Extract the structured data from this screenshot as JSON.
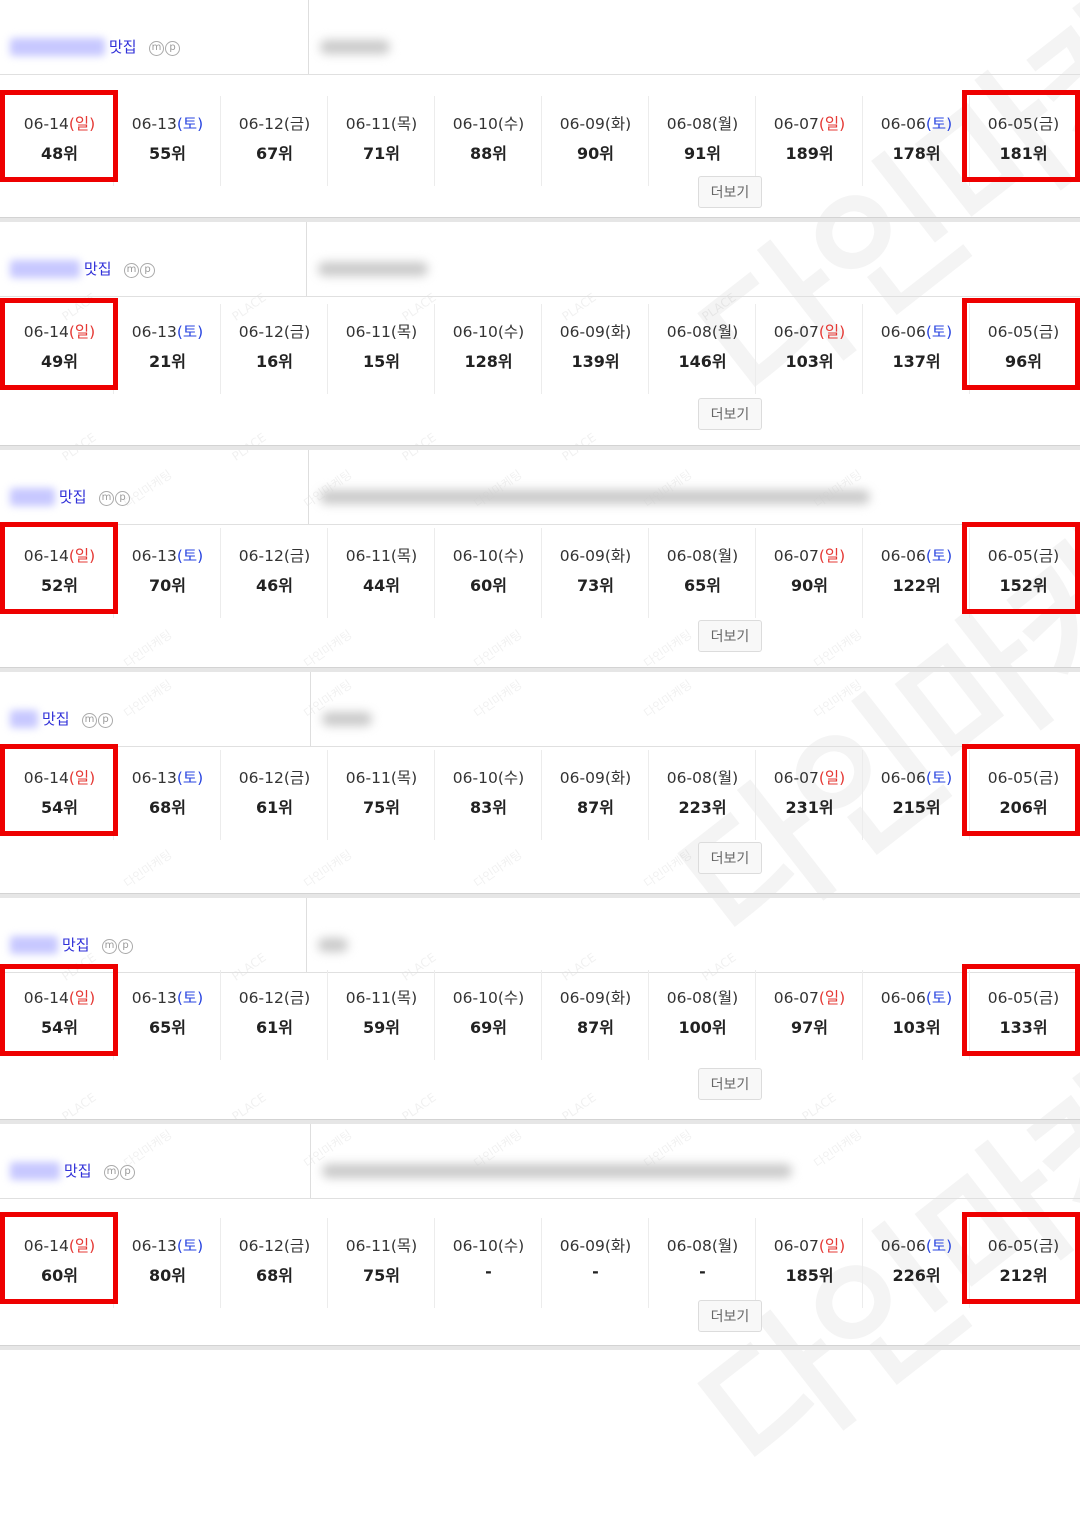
{
  "watermark_small": "다인마케팅",
  "watermark_place": "PLACE",
  "watermark_big": "다인마케",
  "blocks": [
    {
      "keyword_suffix": "맛집",
      "icons": [
        "m",
        "p"
      ],
      "more_label": "더보기",
      "days": [
        {
          "date": "06-14",
          "day": "(일)",
          "rank": "48위"
        },
        {
          "date": "06-13",
          "day": "(토)",
          "rank": "55위"
        },
        {
          "date": "06-12",
          "day": "(금)",
          "rank": "67위"
        },
        {
          "date": "06-11",
          "day": "(목)",
          "rank": "71위"
        },
        {
          "date": "06-10",
          "day": "(수)",
          "rank": "88위"
        },
        {
          "date": "06-09",
          "day": "(화)",
          "rank": "90위"
        },
        {
          "date": "06-08",
          "day": "(월)",
          "rank": "91위"
        },
        {
          "date": "06-07",
          "day": "(일)",
          "rank": "189위"
        },
        {
          "date": "06-06",
          "day": "(토)",
          "rank": "178위"
        },
        {
          "date": "06-05",
          "day": "(금)",
          "rank": "181위"
        }
      ]
    },
    {
      "keyword_suffix": "맛집",
      "icons": [
        "m",
        "p"
      ],
      "more_label": "더보기",
      "days": [
        {
          "date": "06-14",
          "day": "(일)",
          "rank": "49위"
        },
        {
          "date": "06-13",
          "day": "(토)",
          "rank": "21위"
        },
        {
          "date": "06-12",
          "day": "(금)",
          "rank": "16위"
        },
        {
          "date": "06-11",
          "day": "(목)",
          "rank": "15위"
        },
        {
          "date": "06-10",
          "day": "(수)",
          "rank": "128위"
        },
        {
          "date": "06-09",
          "day": "(화)",
          "rank": "139위"
        },
        {
          "date": "06-08",
          "day": "(월)",
          "rank": "146위"
        },
        {
          "date": "06-07",
          "day": "(일)",
          "rank": "103위"
        },
        {
          "date": "06-06",
          "day": "(토)",
          "rank": "137위"
        },
        {
          "date": "06-05",
          "day": "(금)",
          "rank": "96위"
        }
      ]
    },
    {
      "keyword_suffix": "맛집",
      "icons": [
        "m",
        "p"
      ],
      "more_label": "더보기",
      "days": [
        {
          "date": "06-14",
          "day": "(일)",
          "rank": "52위"
        },
        {
          "date": "06-13",
          "day": "(토)",
          "rank": "70위"
        },
        {
          "date": "06-12",
          "day": "(금)",
          "rank": "46위"
        },
        {
          "date": "06-11",
          "day": "(목)",
          "rank": "44위"
        },
        {
          "date": "06-10",
          "day": "(수)",
          "rank": "60위"
        },
        {
          "date": "06-09",
          "day": "(화)",
          "rank": "73위"
        },
        {
          "date": "06-08",
          "day": "(월)",
          "rank": "65위"
        },
        {
          "date": "06-07",
          "day": "(일)",
          "rank": "90위"
        },
        {
          "date": "06-06",
          "day": "(토)",
          "rank": "122위"
        },
        {
          "date": "06-05",
          "day": "(금)",
          "rank": "152위"
        }
      ]
    },
    {
      "keyword_suffix": "맛집",
      "icons": [
        "m",
        "p"
      ],
      "more_label": "더보기",
      "days": [
        {
          "date": "06-14",
          "day": "(일)",
          "rank": "54위"
        },
        {
          "date": "06-13",
          "day": "(토)",
          "rank": "68위"
        },
        {
          "date": "06-12",
          "day": "(금)",
          "rank": "61위"
        },
        {
          "date": "06-11",
          "day": "(목)",
          "rank": "75위"
        },
        {
          "date": "06-10",
          "day": "(수)",
          "rank": "83위"
        },
        {
          "date": "06-09",
          "day": "(화)",
          "rank": "87위"
        },
        {
          "date": "06-08",
          "day": "(월)",
          "rank": "223위"
        },
        {
          "date": "06-07",
          "day": "(일)",
          "rank": "231위"
        },
        {
          "date": "06-06",
          "day": "(토)",
          "rank": "215위"
        },
        {
          "date": "06-05",
          "day": "(금)",
          "rank": "206위"
        }
      ]
    },
    {
      "keyword_suffix": "맛집",
      "icons": [
        "m",
        "p"
      ],
      "more_label": "더보기",
      "days": [
        {
          "date": "06-14",
          "day": "(일)",
          "rank": "54위"
        },
        {
          "date": "06-13",
          "day": "(토)",
          "rank": "65위"
        },
        {
          "date": "06-12",
          "day": "(금)",
          "rank": "61위"
        },
        {
          "date": "06-11",
          "day": "(목)",
          "rank": "59위"
        },
        {
          "date": "06-10",
          "day": "(수)",
          "rank": "69위"
        },
        {
          "date": "06-09",
          "day": "(화)",
          "rank": "87위"
        },
        {
          "date": "06-08",
          "day": "(월)",
          "rank": "100위"
        },
        {
          "date": "06-07",
          "day": "(일)",
          "rank": "97위"
        },
        {
          "date": "06-06",
          "day": "(토)",
          "rank": "103위"
        },
        {
          "date": "06-05",
          "day": "(금)",
          "rank": "133위"
        }
      ]
    },
    {
      "keyword_suffix": "맛집",
      "icons": [
        "m",
        "p"
      ],
      "more_label": "더보기",
      "days": [
        {
          "date": "06-14",
          "day": "(일)",
          "rank": "60위"
        },
        {
          "date": "06-13",
          "day": "(토)",
          "rank": "80위"
        },
        {
          "date": "06-12",
          "day": "(금)",
          "rank": "68위"
        },
        {
          "date": "06-11",
          "day": "(목)",
          "rank": "75위"
        },
        {
          "date": "06-10",
          "day": "(수)",
          "rank": "-"
        },
        {
          "date": "06-09",
          "day": "(화)",
          "rank": "-"
        },
        {
          "date": "06-08",
          "day": "(월)",
          "rank": "-"
        },
        {
          "date": "06-07",
          "day": "(일)",
          "rank": "185위"
        },
        {
          "date": "06-06",
          "day": "(토)",
          "rank": "226위"
        },
        {
          "date": "06-05",
          "day": "(금)",
          "rank": "212위"
        }
      ]
    }
  ]
}
